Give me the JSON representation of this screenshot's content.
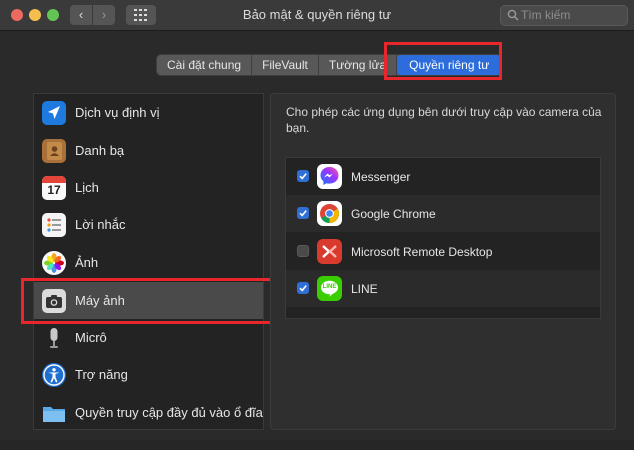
{
  "window": {
    "title": "Bảo mật & quyền riêng tư"
  },
  "search": {
    "placeholder": "Tìm kiếm",
    "icon": "search-icon"
  },
  "tabs": [
    {
      "label": "Cài đặt chung",
      "active": false
    },
    {
      "label": "FileVault",
      "active": false
    },
    {
      "label": "Tường lửa",
      "active": false
    },
    {
      "label": "Quyền riêng tư",
      "active": true
    }
  ],
  "sidebar": {
    "items": [
      {
        "label": "Dịch vụ định vị",
        "icon": "location-arrow-icon",
        "selected": false
      },
      {
        "label": "Danh bạ",
        "icon": "contacts-book-icon",
        "selected": false
      },
      {
        "label": "Lịch",
        "icon": "calendar-icon",
        "selected": false
      },
      {
        "label": "Lời nhắc",
        "icon": "reminders-icon",
        "selected": false
      },
      {
        "label": "Ảnh",
        "icon": "photos-flower-icon",
        "selected": false
      },
      {
        "label": "Máy ảnh",
        "icon": "camera-icon",
        "selected": true
      },
      {
        "label": "Micrô",
        "icon": "microphone-icon",
        "selected": false
      },
      {
        "label": "Trợ năng",
        "icon": "accessibility-icon",
        "selected": false
      },
      {
        "label": "Quyền truy cập đầy đủ vào ổ đĩa",
        "icon": "folder-icon",
        "selected": false
      }
    ],
    "calendar_day": "17"
  },
  "main": {
    "description": "Cho phép các ứng dụng bên dưới truy cập vào camera của bạn.",
    "apps": [
      {
        "label": "Messenger",
        "checked": true,
        "icon": "messenger-icon"
      },
      {
        "label": "Google Chrome",
        "checked": true,
        "icon": "chrome-icon"
      },
      {
        "label": "Microsoft Remote Desktop",
        "checked": false,
        "icon": "remote-desktop-icon"
      },
      {
        "label": "LINE",
        "checked": true,
        "icon": "line-icon"
      }
    ],
    "line_icon_text": "LINE"
  },
  "colors": {
    "highlight": "#e8262b",
    "accent": "#2c6ddb"
  }
}
